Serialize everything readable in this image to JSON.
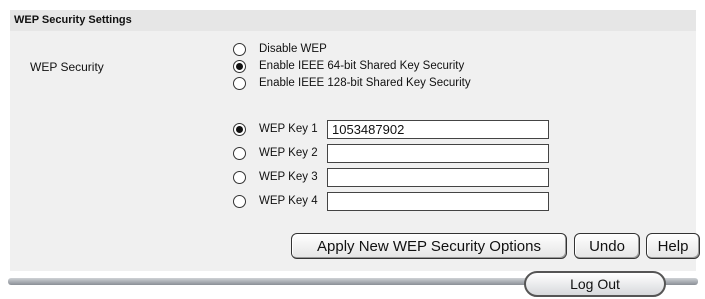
{
  "section": {
    "title": "WEP Security Settings"
  },
  "wep_security": {
    "label": "WEP Security",
    "options": [
      {
        "label": "Disable WEP",
        "selected": false
      },
      {
        "label": "Enable IEEE 64-bit Shared Key Security",
        "selected": true
      },
      {
        "label": "Enable IEEE 128-bit Shared Key Security",
        "selected": false
      }
    ]
  },
  "keys": [
    {
      "label": "WEP Key 1",
      "value": "1053487902",
      "selected": true
    },
    {
      "label": "WEP Key 2",
      "value": "",
      "selected": false
    },
    {
      "label": "WEP Key 3",
      "value": "",
      "selected": false
    },
    {
      "label": "WEP Key 4",
      "value": "",
      "selected": false
    }
  ],
  "buttons": {
    "apply": "Apply New WEP Security Options",
    "undo": "Undo",
    "help": "Help"
  },
  "footer": {
    "logout": "Log Out"
  }
}
